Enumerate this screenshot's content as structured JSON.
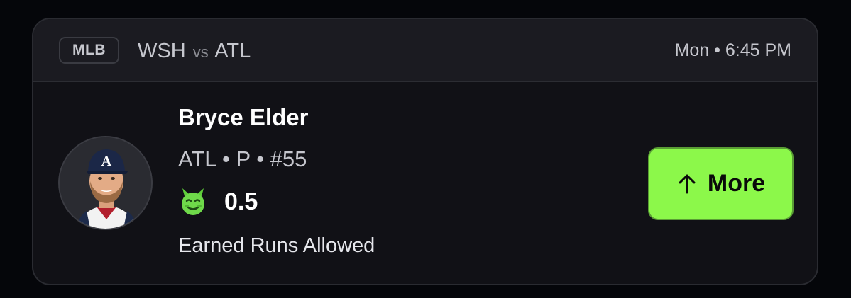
{
  "header": {
    "league": "MLB",
    "home_team": "WSH",
    "vs": "vs",
    "away_team": "ATL",
    "game_time": "Mon • 6:45 PM"
  },
  "player": {
    "name": "Bryce Elder",
    "meta": "ATL • P • #55",
    "avatar_icon": "player-headshot"
  },
  "projection": {
    "icon": "demon-icon",
    "line": "0.5",
    "stat": "Earned Runs Allowed"
  },
  "action": {
    "label": "More",
    "icon": "arrow-up-icon",
    "color": "#8cf84a"
  },
  "colors": {
    "background": "#05060a",
    "card": "#111116",
    "header": "#1b1b21",
    "accent": "#8cf84a"
  }
}
